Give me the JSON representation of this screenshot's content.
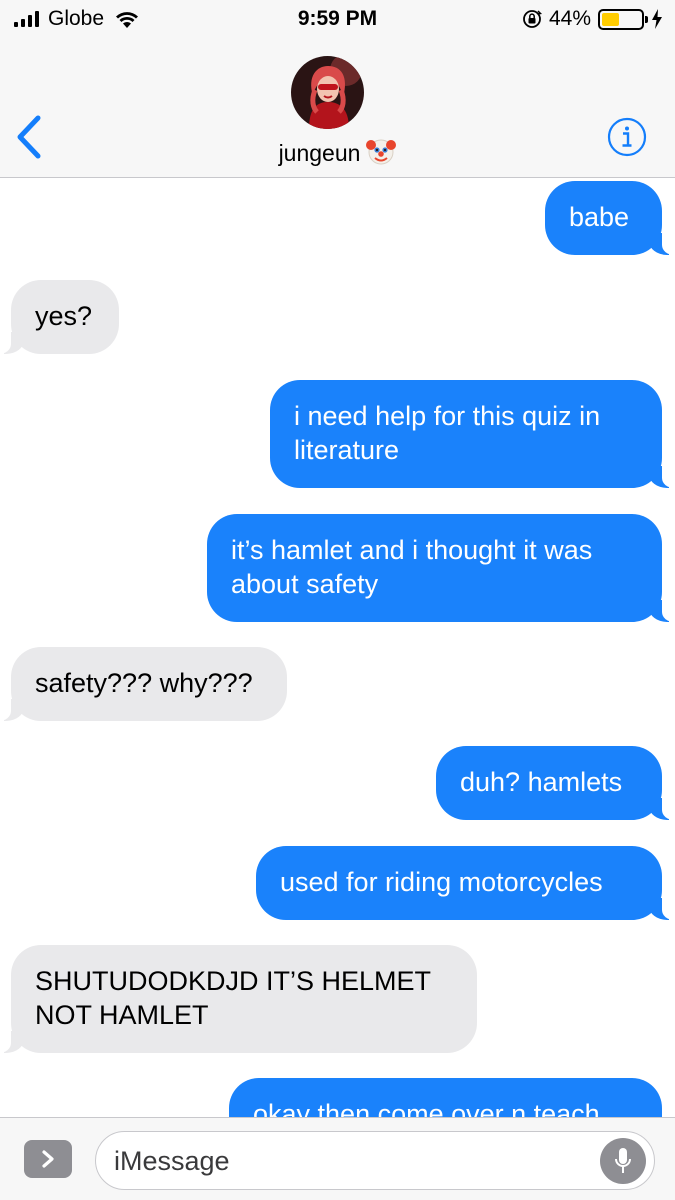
{
  "status_bar": {
    "carrier": "Globe",
    "time": "9:59 PM",
    "battery_percent": "44%",
    "battery_level": 0.44
  },
  "conversation": {
    "contact_name": "jungeun",
    "contact_emoji_icon": "clown-face-icon"
  },
  "messages": [
    {
      "side": "out",
      "text": "babe"
    },
    {
      "side": "in",
      "text": "yes?"
    },
    {
      "side": "out",
      "text": "i need help for this quiz in literature"
    },
    {
      "side": "out",
      "text": "it’s hamlet and i thought it was about safety"
    },
    {
      "side": "in",
      "text": "safety??? why???"
    },
    {
      "side": "out",
      "text": "duh? hamlets"
    },
    {
      "side": "out",
      "text": "used for riding motorcycles"
    },
    {
      "side": "in",
      "text": "SHUTUDODKDJD IT’S HELMET NOT HAMLET"
    },
    {
      "side": "out",
      "text": "okay then come over n teach"
    }
  ],
  "composer": {
    "placeholder": "iMessage"
  },
  "colors": {
    "outgoing_bubble": "#1a82fb",
    "incoming_bubble": "#e9e9eb",
    "accent": "#147efb",
    "battery_fill": "#ffcc00"
  }
}
